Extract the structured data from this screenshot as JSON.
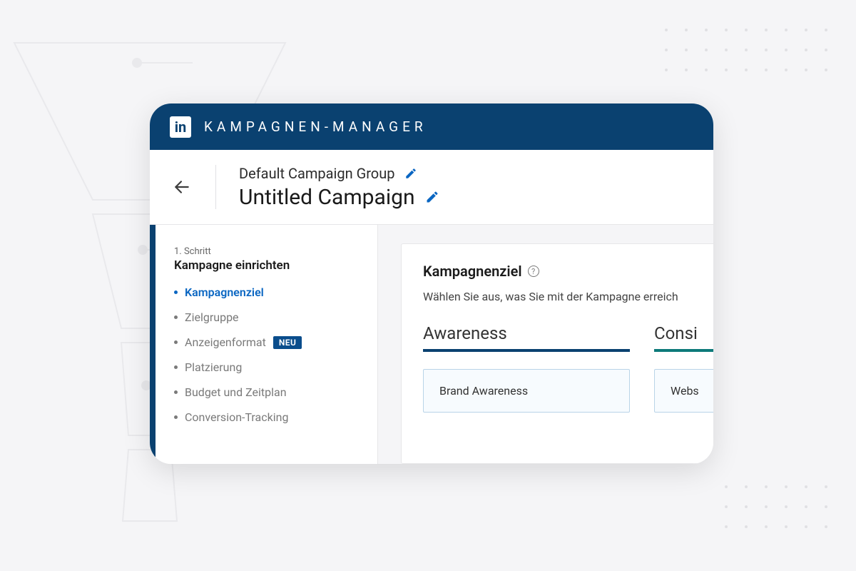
{
  "titlebar": {
    "logo_text": "in",
    "title": "KAMPAGNEN-MANAGER"
  },
  "header": {
    "campaign_group": "Default Campaign Group",
    "campaign_name": "Untitled Campaign"
  },
  "sidebar": {
    "step_over": "1. Schritt",
    "step_title": "Kampagne einrichten",
    "items": [
      {
        "label": "Kampagnenziel",
        "active": true
      },
      {
        "label": "Zielgruppe"
      },
      {
        "label": "Anzeigenformat",
        "badge": "NEU"
      },
      {
        "label": "Platzierung"
      },
      {
        "label": "Budget und Zeitplan"
      },
      {
        "label": "Conversion-Tracking"
      }
    ]
  },
  "panel": {
    "heading": "Kampagnenziel",
    "subtitle": "Wählen Sie aus, was Sie mit der Kampagne erreich",
    "columns": [
      {
        "heading": "Awareness",
        "options": [
          "Brand Awareness"
        ]
      },
      {
        "heading": "Consi",
        "options": [
          "Webs"
        ]
      }
    ]
  }
}
